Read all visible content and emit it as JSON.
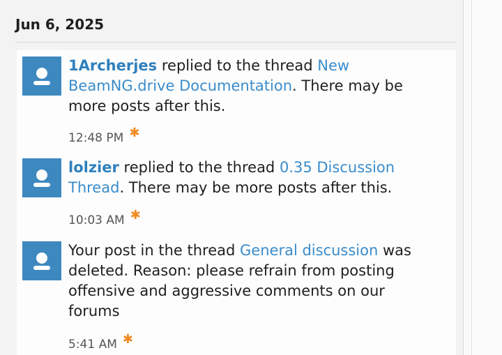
{
  "date_heading": "Jun 6, 2025",
  "alerts": [
    {
      "user": "1Archerjes",
      "text_before": " replied to the thread ",
      "link": "New BeamNG.drive Documentation",
      "text_after": ". There may be more posts after this.",
      "time": "12:48 PM",
      "unread_icon": "asterisk-icon"
    },
    {
      "user": "lolzier",
      "text_before": " replied to the thread ",
      "link": "0.35 Discussion Thread",
      "text_after": ". There may be more posts after this.",
      "time": "10:03 AM",
      "unread_icon": "asterisk-icon"
    },
    {
      "user": "",
      "text_before": "Your post in the thread ",
      "link": "General discussion",
      "text_after": " was deleted. Reason: please refrain from posting offensive and aggressive comments on our forums",
      "time": "5:41 AM",
      "unread_icon": "asterisk-icon"
    }
  ],
  "colors": {
    "avatar_bg": "#3e88c0",
    "link": "#3a8ccb",
    "unread_star": "#f08a23"
  }
}
